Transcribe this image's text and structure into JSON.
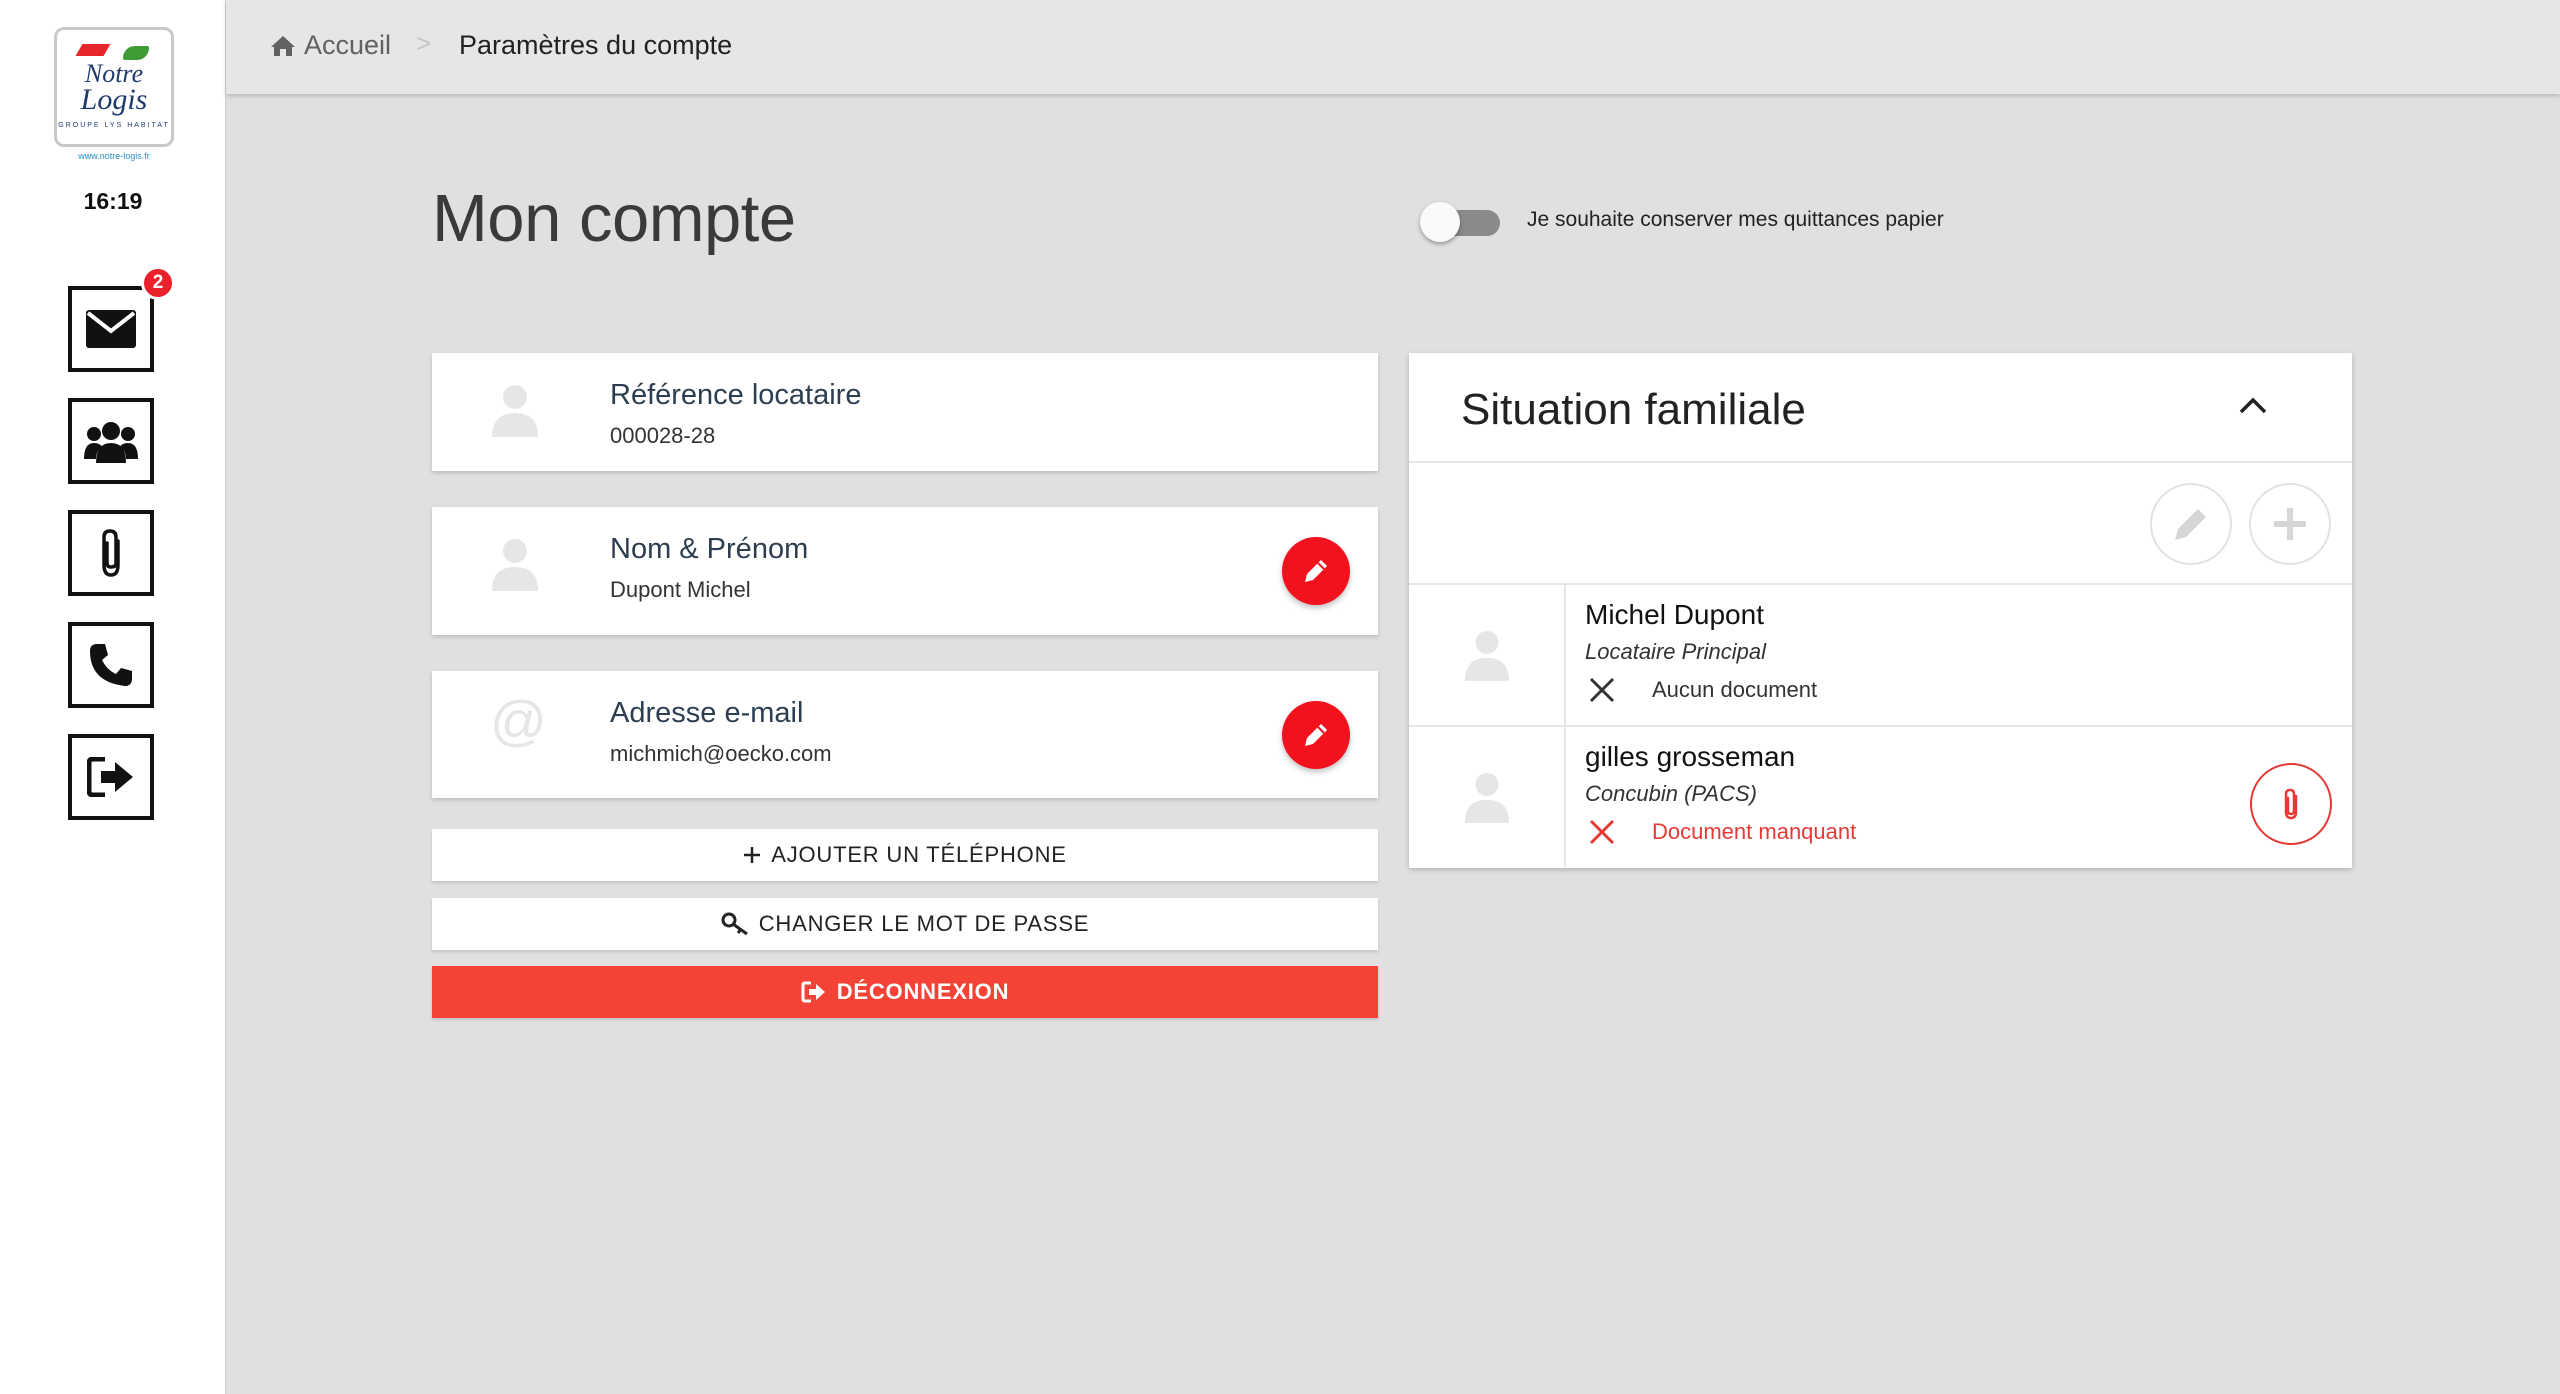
{
  "sidebar": {
    "logo": {
      "line1": "Notre",
      "line2": "Logis",
      "sub": "GROUPE LYS HABITAT"
    },
    "logo_url": "www.notre-logis.fr",
    "clock": "16:19",
    "nav": [
      {
        "icon": "envelope-icon",
        "badge": "2"
      },
      {
        "icon": "users-icon"
      },
      {
        "icon": "paperclip-icon"
      },
      {
        "icon": "phone-icon"
      },
      {
        "icon": "sign-out-icon"
      }
    ]
  },
  "breadcrumb": {
    "home": "Accueil",
    "separator": ">",
    "current": "Paramètres du compte"
  },
  "page": {
    "title": "Mon compte",
    "paper_toggle": {
      "label": "Je souhaite conserver mes quittances papier",
      "on": false
    }
  },
  "cards": {
    "reference": {
      "title": "Référence locataire",
      "value": "000028-28"
    },
    "name": {
      "title": "Nom & Prénom",
      "value": "Dupont Michel"
    },
    "email": {
      "title": "Adresse e-mail",
      "value": "michmich@oecko.com"
    }
  },
  "actions": {
    "add_phone": "AJOUTER UN TÉLÉPHONE",
    "change_password": "CHANGER LE MOT DE PASSE",
    "logout": "DÉCONNEXION"
  },
  "family": {
    "title": "Situation familiale",
    "members": [
      {
        "name": "Michel Dupont",
        "role": "Locataire Principal",
        "document_status": "Aucun document",
        "missing": false
      },
      {
        "name": "gilles grosseman",
        "role": "Concubin (PACS)",
        "document_status": "Document manquant",
        "missing": true
      }
    ]
  },
  "colors": {
    "accent_red": "#f2121e",
    "logout_red": "#f44336",
    "missing_red": "#e53935",
    "badge_red": "#e8212b"
  }
}
